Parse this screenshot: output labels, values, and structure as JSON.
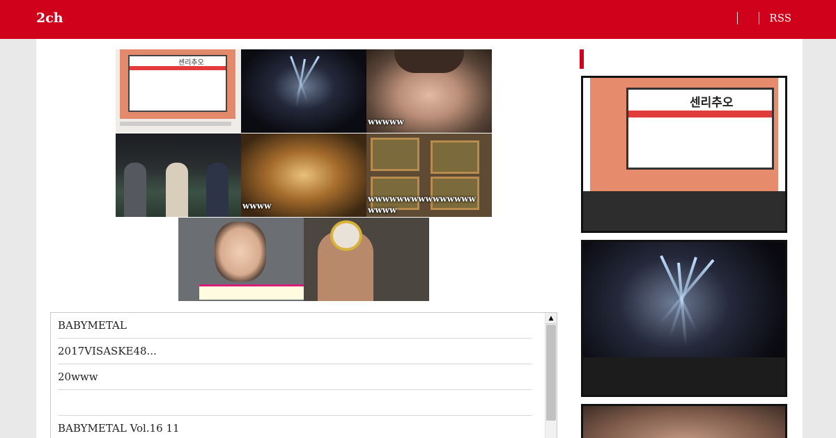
{
  "header": {
    "logo": "2ch",
    "rss_label": "RSS"
  },
  "mosaic": {
    "tiles": [
      {
        "caption": ""
      },
      {
        "caption": ""
      },
      {
        "caption": "wwwww"
      },
      {
        "caption": ""
      },
      {
        "caption": "wwww"
      },
      {
        "caption": "wwwwwwwwwwwwwww\nwwww"
      },
      {
        "caption": ""
      },
      {
        "caption": ""
      }
    ]
  },
  "list": {
    "items": [
      "BABYMETAL",
      "2017VISASKE48...",
      "20www",
      "",
      "BABYMETAL Vol.16 11"
    ]
  },
  "sidebar": {
    "sign_text": "센리추오"
  }
}
